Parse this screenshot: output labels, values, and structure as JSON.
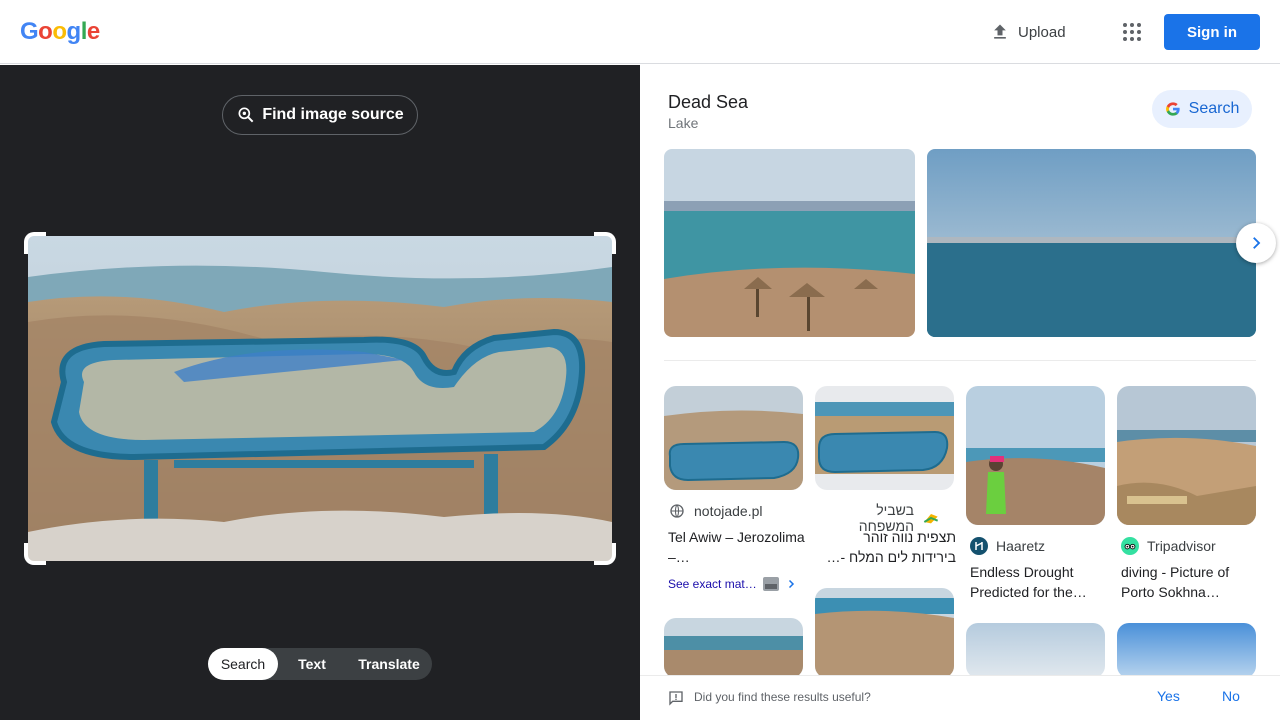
{
  "header": {
    "logo_letters": [
      {
        "ch": "G",
        "color": "#4285F4"
      },
      {
        "ch": "o",
        "color": "#EA4335"
      },
      {
        "ch": "o",
        "color": "#FBBC05"
      },
      {
        "ch": "g",
        "color": "#4285F4"
      },
      {
        "ch": "l",
        "color": "#34A853"
      },
      {
        "ch": "e",
        "color": "#EA4335"
      }
    ],
    "upload_label": "Upload",
    "signin_label": "Sign in"
  },
  "left": {
    "find_source_label": "Find image source",
    "modes": [
      "Search",
      "Text",
      "Translate"
    ],
    "active_mode": "Search"
  },
  "entity": {
    "title": "Dead Sea",
    "subtitle": "Lake",
    "search_label": "Search"
  },
  "results": [
    {
      "source": "notojade.pl",
      "title": "Tel Awiw – Jerozolima –…",
      "source_icon": "globe-icon",
      "rtl": false
    },
    {
      "source": "בשביל המשפחה",
      "title": "תצפית נווה זוהר בירידות לים המלח -…",
      "source_icon": "family-site-icon",
      "rtl": true
    },
    {
      "source": "Haaretz",
      "title": "Endless Drought Predicted for the…",
      "source_icon": "haaretz-icon",
      "rtl": false
    },
    {
      "source": "Tripadvisor",
      "title": "diving - Picture of Porto Sokhna…",
      "source_icon": "tripadvisor-icon",
      "rtl": false
    }
  ],
  "exact_matches_label": "See exact mat…",
  "feedback": {
    "question": "Did you find these results useful?",
    "yes": "Yes",
    "no": "No"
  },
  "colors": {
    "accent": "#1a73e8",
    "left_bg": "#202124"
  }
}
